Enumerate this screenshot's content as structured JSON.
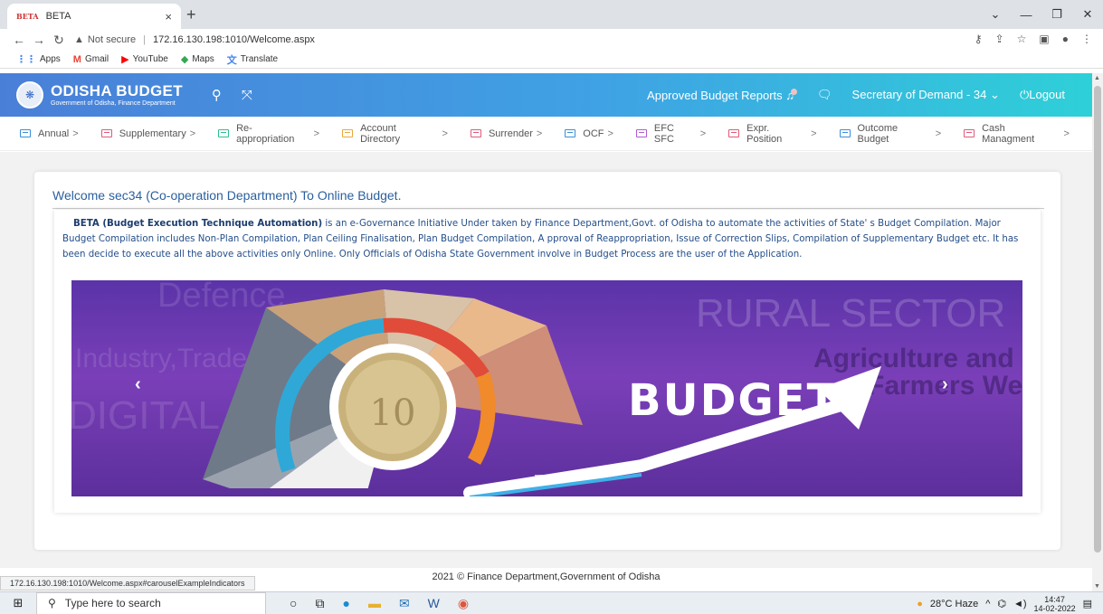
{
  "browser": {
    "tab_favicon": "BETA",
    "tab_title": "BETA",
    "tab_close": "×",
    "new_tab": "+",
    "url_not_secure": "Not secure",
    "url": "172.16.130.198:1010/Welcome.aspx",
    "bookmarks": [
      {
        "label": "Apps",
        "icon": "apps-grid-icon",
        "color": "#4285f4"
      },
      {
        "label": "Gmail",
        "icon": "gmail-icon",
        "color": "#ea4335"
      },
      {
        "label": "YouTube",
        "icon": "youtube-icon",
        "color": "#ff0000"
      },
      {
        "label": "Maps",
        "icon": "maps-icon",
        "color": "#34a853"
      },
      {
        "label": "Translate",
        "icon": "translate-icon",
        "color": "#4285f4"
      }
    ],
    "status_url": "172.16.130.198:1010/Welcome.aspx#carouselExampleIndicators"
  },
  "header": {
    "brand_name": "ODISHA BUDGET",
    "brand_sub": "Government of Odisha, Finance Department",
    "approved_reports": "Approved Budget Reports",
    "role": "Secretary of Demand - 34",
    "logout": "Logout"
  },
  "menu": [
    {
      "label": "Annual",
      "color": "#3a8fd9"
    },
    {
      "label": "Supplementary",
      "color": "#e05a7a"
    },
    {
      "label": "Re-appropriation",
      "color": "#2fbf8f"
    },
    {
      "label": "Account Directory",
      "color": "#e8a93a"
    },
    {
      "label": "Surrender",
      "color": "#e05a7a"
    },
    {
      "label": "OCF",
      "color": "#3a8fd9"
    },
    {
      "label": "EFC SFC",
      "color": "#b05ad0"
    },
    {
      "label": "Expr. Position",
      "color": "#e05a7a"
    },
    {
      "label": "Outcome Budget",
      "color": "#3a8fd9"
    },
    {
      "label": "Cash Managment",
      "color": "#e05a7a"
    }
  ],
  "main": {
    "welcome": "Welcome sec34 (Co-operation Department) To Online Budget.",
    "desc_bold": "BETA (Budget Execution Technique Automation)",
    "desc_rest": " is an e-Governance Initiative Under taken by Finance Department,Govt. of Odisha to automate the activities of State' s Budget Compilation. Major Budget Compilation includes Non-Plan Compilation, Plan Ceiling Finalisation, Plan Budget Compilation, A pproval of Reappropriation, Issue of Correction Slips, Compilation of Supplementary Budget etc. It has been decide to execute all the above activities only Online. Only Officials of Odisha State Government involve in Budget Process are the user of the Application.",
    "carousel": {
      "headline": "BUDGET",
      "bg_text_1": "Defence",
      "bg_text_2": "RURAL SECTOR",
      "bg_text_3": "Industry,Trade & Commerce",
      "bg_text_4": "DIGITAL INDIA",
      "bg_text_5": "Agriculture and",
      "bg_text_6": "Farmers Welfare",
      "coin_value": "10",
      "prev": "‹",
      "next": "›"
    }
  },
  "footer": "2021 © Finance Department,Government of Odisha",
  "taskbar": {
    "search_placeholder": "Type here to search",
    "weather": "28°C  Haze",
    "time": "14:47",
    "date": "14-02-2022"
  }
}
